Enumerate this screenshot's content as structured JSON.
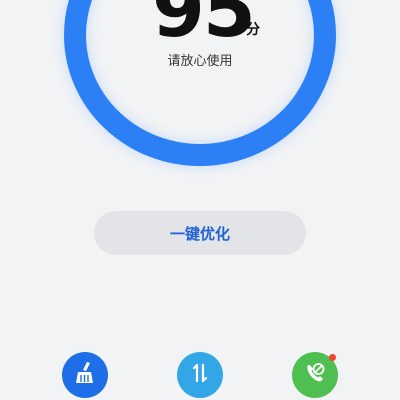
{
  "score": {
    "value": "95",
    "unit": "分",
    "status": "请放心使用",
    "ring_color": "#2d7ff5"
  },
  "optimize_button": {
    "label": "一键优化",
    "text_color": "#1f63d6"
  },
  "tools": [
    {
      "icon": "broom-icon",
      "color": "#1e6ee8"
    },
    {
      "icon": "traffic-arrows-icon",
      "color": "#33a6e8"
    },
    {
      "icon": "blocked-call-icon",
      "color": "#4fbf52",
      "has_badge": true
    }
  ]
}
